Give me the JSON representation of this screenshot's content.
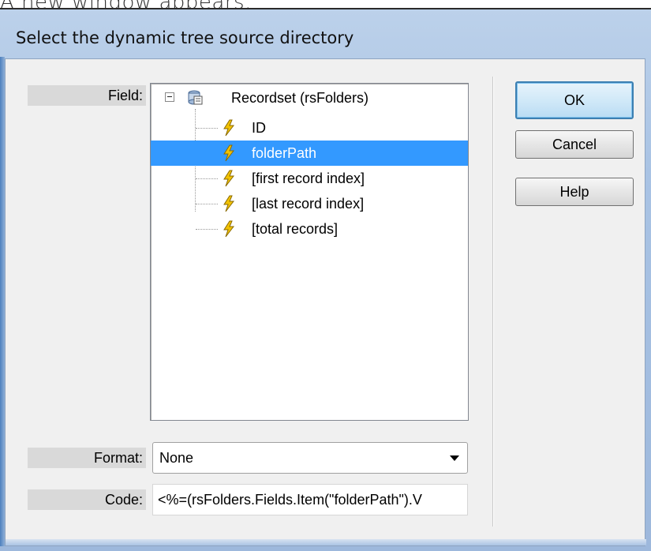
{
  "caption": "A new window appears.",
  "dialog": {
    "title": "Select the dynamic tree source directory"
  },
  "labels": {
    "field": "Field:",
    "format": "Format:",
    "code": "Code:"
  },
  "tree": {
    "root": {
      "label": "Recordset (rsFolders)",
      "icon": "recordset-icon",
      "expanded": true
    },
    "items": [
      {
        "label": "ID",
        "icon": "lightning-icon",
        "selected": false
      },
      {
        "label": "folderPath",
        "icon": "lightning-icon",
        "selected": true
      },
      {
        "label": "[first record index]",
        "icon": "lightning-icon",
        "selected": false
      },
      {
        "label": "[last record index]",
        "icon": "lightning-icon",
        "selected": false
      },
      {
        "label": "[total records]",
        "icon": "lightning-icon",
        "selected": false
      }
    ]
  },
  "format": {
    "selected": "None"
  },
  "code": {
    "value": "<%=(rsFolders.Fields.Item(\"folderPath\").V"
  },
  "buttons": {
    "ok": "OK",
    "cancel": "Cancel",
    "help": "Help"
  },
  "colors": {
    "selection": "#3399ff",
    "titlebar": "#b3cbe8",
    "default_button_border": "#3c7fb1"
  }
}
